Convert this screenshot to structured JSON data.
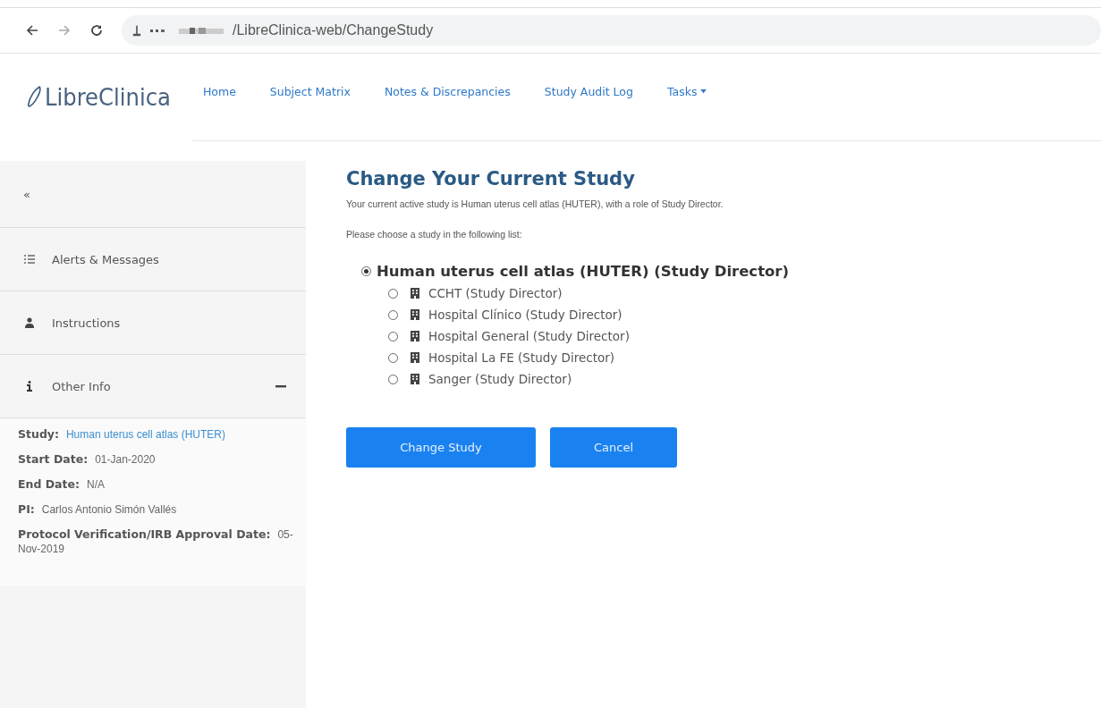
{
  "browser": {
    "url": "/LibreClinica-web/ChangeStudy"
  },
  "header": {
    "logo": "LibreClinica",
    "nav": [
      {
        "label": "Home",
        "dropdown": false
      },
      {
        "label": "Subject Matrix",
        "dropdown": false
      },
      {
        "label": "Notes & Discrepancies",
        "dropdown": false
      },
      {
        "label": "Study Audit Log",
        "dropdown": false
      },
      {
        "label": "Tasks",
        "dropdown": true
      }
    ]
  },
  "sidebar": {
    "collapse": "«",
    "items": [
      {
        "kind": "alerts",
        "label": "Alerts & Messages"
      },
      {
        "kind": "instructions",
        "label": "Instructions"
      },
      {
        "kind": "info",
        "label": "Other Info",
        "expanded": true
      }
    ],
    "info": [
      {
        "label": "Study:",
        "value": "Human uterus cell atlas (HUTER)",
        "link": true
      },
      {
        "label": "Start Date:",
        "value": "01-Jan-2020",
        "link": false
      },
      {
        "label": "End Date:",
        "value": "N/A",
        "link": false
      },
      {
        "label": "PI:",
        "value": "Carlos Antonio Simón Vallés",
        "link": false
      },
      {
        "label": "Protocol Verification/IRB Approval Date:",
        "value": "05-Nov-2019",
        "link": false
      }
    ]
  },
  "main": {
    "title": "Change Your Current Study",
    "current": "Your current active study is Human uterus cell atlas (HUTER), with a role of Study Director.",
    "prompt": "Please choose a study in the following list:",
    "studies": [
      {
        "label": "Human uterus cell atlas (HUTER) (Study Director)",
        "selected": true,
        "children": [
          {
            "label": "CCHT (Study Director)",
            "selected": false
          },
          {
            "label": "Hospital Clínico (Study Director)",
            "selected": false
          },
          {
            "label": "Hospital General (Study Director)",
            "selected": false
          },
          {
            "label": "Hospital La FE (Study Director)",
            "selected": false
          },
          {
            "label": "Sanger (Study Director)",
            "selected": false
          }
        ]
      }
    ],
    "buttons": [
      "Change Study",
      "Cancel"
    ]
  }
}
